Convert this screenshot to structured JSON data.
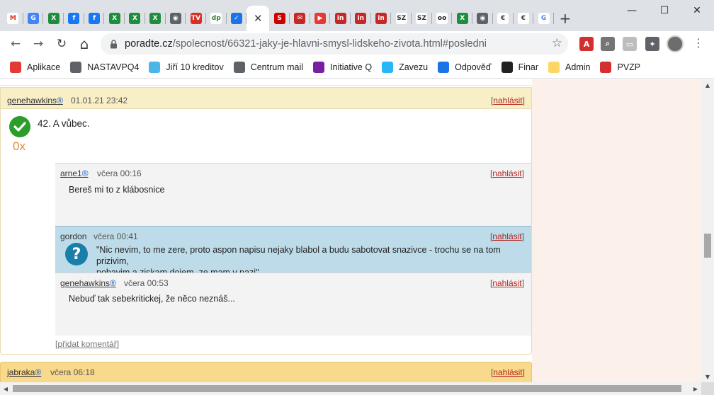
{
  "window": {
    "tabs": [
      {
        "icon": "gmail-icon",
        "label": "M",
        "color": "#ffffff",
        "fg": "#d93025"
      },
      {
        "icon": "translate-icon",
        "label": "G",
        "color": "#4285f4"
      },
      {
        "icon": "sheet-icon",
        "label": "X",
        "color": "#1e8e3e"
      },
      {
        "icon": "facebook-icon",
        "label": "f",
        "color": "#1877f2"
      },
      {
        "icon": "facebook-icon",
        "label": "f",
        "color": "#1877f2"
      },
      {
        "icon": "sheet-icon",
        "label": "X",
        "color": "#1e8e3e"
      },
      {
        "icon": "sheet-icon",
        "label": "X",
        "color": "#1e8e3e"
      },
      {
        "icon": "sheet-icon",
        "label": "X",
        "color": "#1e8e3e"
      },
      {
        "icon": "globe-icon",
        "label": "◉",
        "color": "#5f6368"
      },
      {
        "icon": "tv-icon",
        "label": "TV",
        "color": "#d93025"
      },
      {
        "icon": "dp-icon",
        "label": "dp",
        "color": "#ffffff",
        "fg": "#2e7d32"
      },
      {
        "icon": "checkbox-icon",
        "label": "✓",
        "color": "#1a73e8"
      },
      {
        "icon": "close-icon",
        "label": "✕",
        "active": true
      },
      {
        "icon": "seznam-icon",
        "label": "S",
        "color": "#cc0000"
      },
      {
        "icon": "mail-icon",
        "label": "✉",
        "color": "#c62828"
      },
      {
        "icon": "youtube-icon",
        "label": "▶",
        "color": "#e53935"
      },
      {
        "icon": "linkedin-icon",
        "label": "in",
        "color": "#c62828"
      },
      {
        "icon": "linkedin-icon",
        "label": "in",
        "color": "#c62828"
      },
      {
        "icon": "linkedin-icon",
        "label": "in",
        "color": "#c62828"
      },
      {
        "icon": "sz-icon",
        "label": "SZ",
        "color": "#ffffff",
        "fg": "#333333"
      },
      {
        "icon": "sz-icon",
        "label": "SZ",
        "color": "#ffffff",
        "fg": "#333333"
      },
      {
        "icon": "bike-icon",
        "label": "oo",
        "color": "#ffffff",
        "fg": "#222222"
      },
      {
        "icon": "sheet-icon",
        "label": "X",
        "color": "#1e8e3e"
      },
      {
        "icon": "globe-icon",
        "label": "◉",
        "color": "#5f6368"
      },
      {
        "icon": "euro-icon",
        "label": "€",
        "color": "#ffffff",
        "fg": "#444444"
      },
      {
        "icon": "euro-icon",
        "label": "€",
        "color": "#ffffff",
        "fg": "#444444"
      },
      {
        "icon": "google-icon",
        "label": "G",
        "color": "#ffffff",
        "fg": "#4285f4"
      }
    ],
    "new_tab": "+",
    "minimize": "—",
    "maximize": "☐",
    "close": "✕"
  },
  "toolbar": {
    "back": "←",
    "forward": "→",
    "reload": "↻",
    "home": "⌂",
    "url_host": "poradte.cz",
    "url_path": "/spolecnost/66321-jaky-je-hlavni-smysl-lidskeho-zivota.html#posledni",
    "star": "☆"
  },
  "extensions": [
    {
      "name": "pdf-extension-icon",
      "label": "A",
      "color": "#d32f2f"
    },
    {
      "name": "search-extension-icon",
      "label": "⌕",
      "color": "#757575"
    },
    {
      "name": "cast-extension-icon",
      "label": "▭",
      "color": "#bdbdbd"
    },
    {
      "name": "puzzle-extensions-icon",
      "label": "✦",
      "color": "#5f6368"
    }
  ],
  "bookmarks": [
    {
      "label": "Aplikace",
      "icon": "apps-grid-icon",
      "color": "#e53935"
    },
    {
      "label": "NASTAVPQ4",
      "icon": "globe-icon",
      "color": "#5f6368"
    },
    {
      "label": "Jiří 10 kreditov",
      "icon": "gear-icon",
      "color": "#4db6e8"
    },
    {
      "label": "Centrum mail",
      "icon": "mail-icon",
      "color": "#5f6368"
    },
    {
      "label": "Initiative Q",
      "icon": "q-icon",
      "color": "#7b1fa2"
    },
    {
      "label": "Zavezu",
      "icon": "zavezu-icon",
      "color": "#29b6f6"
    },
    {
      "label": "Odpověď",
      "icon": "checkbox-icon",
      "color": "#1a73e8"
    },
    {
      "label": "Finar",
      "icon": "bike-icon",
      "color": "#222222"
    },
    {
      "label": "Admin",
      "icon": "folder-icon",
      "color": "#fdd663"
    },
    {
      "label": "PVZP",
      "icon": "pvzp-icon",
      "color": "#d32f2f"
    }
  ],
  "answer": {
    "author": "genehawkins",
    "reg_mark": "®",
    "date": "01.01.21 23:42",
    "report_label": "nahlásit",
    "text": "42. A vůbec.",
    "votes": "0x",
    "add_comment": "přidat komentář",
    "comments": [
      {
        "author": "arne1",
        "reg": "®",
        "date": "včera 00:16",
        "report": "nahlásit",
        "text": "Bereš mi to z klábosnice"
      },
      {
        "author": "gordon",
        "reg": "",
        "date": "včera 00:41",
        "report": "nahlásit",
        "text_line1": "\"Nic nevim, to me zere, proto aspon napisu nejaky blabol a budu sabotovat snazivce - trochu se na tom prizivim,",
        "text_line2": "pobavim a ziskam dojem, ze mam v pazi\""
      },
      {
        "author": "genehawkins",
        "reg": "®",
        "date": "včera 00:53",
        "report": "nahlásit",
        "text": "Nebuď tak sebekritickej, že něco neznáš..."
      }
    ]
  },
  "next_answer": {
    "author": "jabraka",
    "reg_mark": "®",
    "date": "včera 06:18",
    "report_label": "nahlásit"
  }
}
